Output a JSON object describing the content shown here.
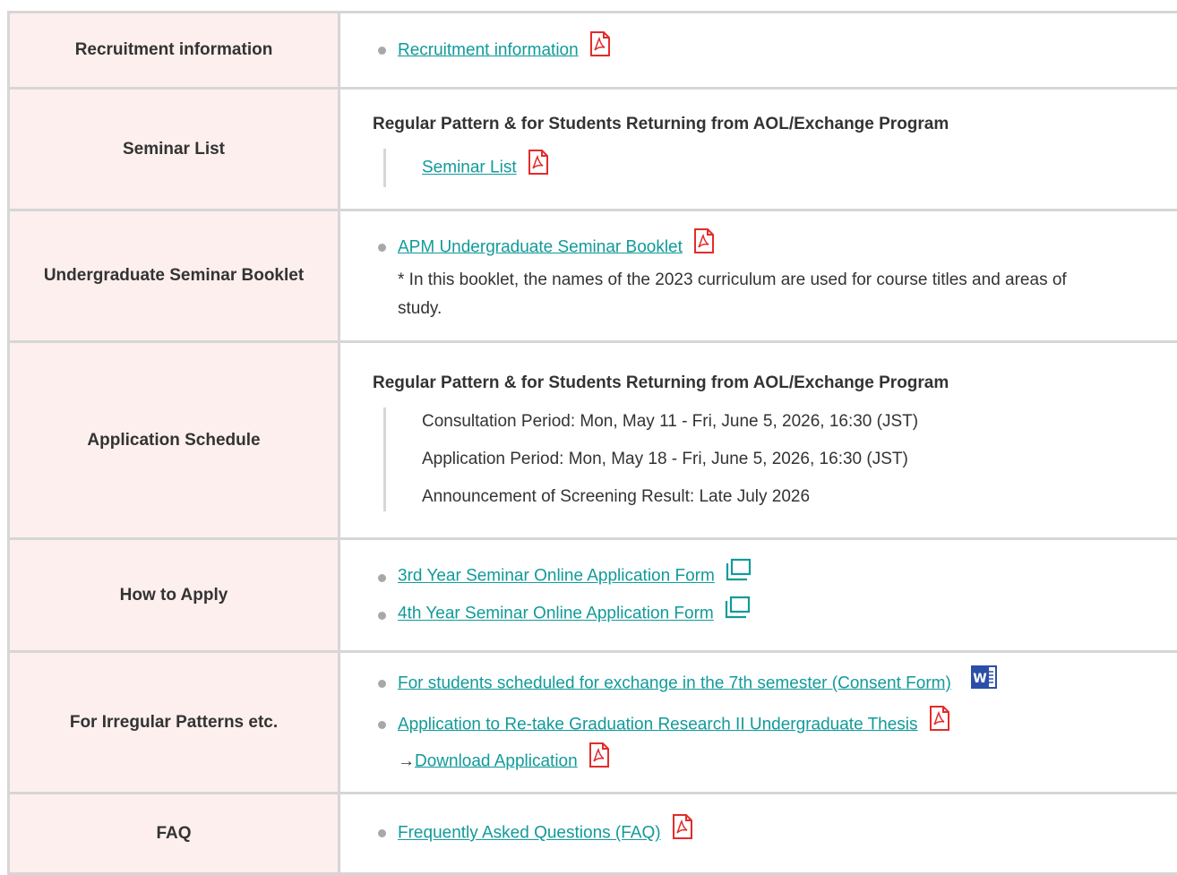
{
  "rows": [
    {
      "label": "Recruitment information",
      "links": [
        {
          "text": "Recruitment information",
          "icon": "pdf-icon"
        }
      ]
    },
    {
      "label": "Seminar List",
      "subheading": "Regular Pattern & for Students Returning from AOL/Exchange Program",
      "quote_link": {
        "text": "Seminar List",
        "icon": "pdf-icon"
      }
    },
    {
      "label": "Undergraduate Seminar Booklet",
      "links": [
        {
          "text": "APM Undergraduate Seminar Booklet",
          "icon": "pdf-icon",
          "note": "* In this booklet, the names of the 2023 curriculum are used for course titles and areas of study."
        }
      ]
    },
    {
      "label": "Application Schedule",
      "subheading": "Regular Pattern & for Students Returning from AOL/Exchange Program",
      "lines": [
        "Consultation Period: Mon, May 11 - Fri, June 5, 2026, 16:30 (JST)",
        "Application Period: Mon, May 18 - Fri, June 5, 2026, 16:30 (JST)",
        "Announcement of Screening Result: Late July 2026"
      ]
    },
    {
      "label": "How to Apply",
      "links": [
        {
          "text": "3rd Year Seminar Online Application Form",
          "icon": "external-window-icon"
        },
        {
          "text": "4th Year Seminar Online Application Form",
          "icon": "external-window-icon"
        }
      ]
    },
    {
      "label": "For Irregular Patterns etc.",
      "links": [
        {
          "text": "For students scheduled for exchange in the 7th semester (Consent Form)",
          "icon": "word-doc-icon"
        },
        {
          "text": "Application to Re-take Graduation Research II Undergraduate Thesis",
          "icon": "pdf-icon",
          "arrow": "→",
          "sub_link": "Download Application",
          "sub_icon": "pdf-icon"
        }
      ]
    },
    {
      "label": "FAQ",
      "links": [
        {
          "text": "Frequently Asked Questions (FAQ)",
          "icon": "pdf-icon"
        }
      ]
    }
  ],
  "colors": {
    "header_bg": "#fdefed",
    "border": "#d6d6d6",
    "link": "#129a9a",
    "pdf_red": "#e32b2b",
    "word_blue": "#2b4ea8",
    "bullet": "#a8a8a8"
  }
}
